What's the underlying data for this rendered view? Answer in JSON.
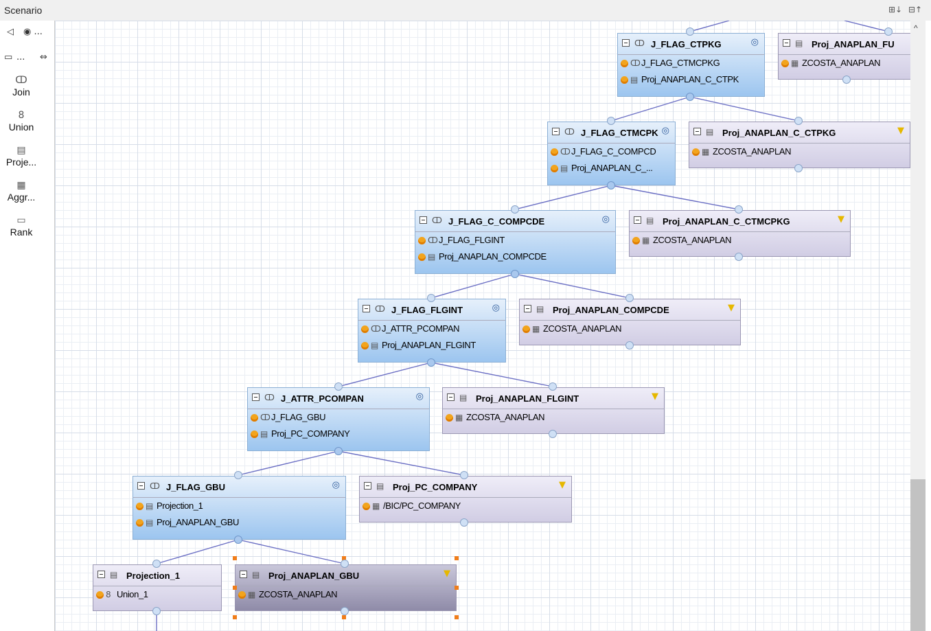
{
  "window": {
    "title": "Scenario",
    "expand_icon": "⊞↓",
    "collapse_icon": "⊟↑"
  },
  "palette": {
    "top_icons": [
      "◁",
      "◉ ..."
    ],
    "folder_label": "...",
    "items": [
      {
        "label": "Join",
        "icon": "join-icon",
        "glyph": "ↀ"
      },
      {
        "label": "Union",
        "icon": "union-icon",
        "glyph": "8"
      },
      {
        "label": "Proje...",
        "icon": "projection-icon",
        "glyph": "▤"
      },
      {
        "label": "Aggr...",
        "icon": "aggregation-icon",
        "glyph": "▦"
      },
      {
        "label": "Rank",
        "icon": "rank-icon",
        "glyph": "▭"
      }
    ]
  },
  "nodes": {
    "j_flag_ctpkg": {
      "title": "J_FLAG_CTPKG",
      "rows": [
        "J_FLAG_CTMCPKG",
        "Proj_ANAPLAN_C_CTPK"
      ]
    },
    "proj_anaplan_fu": {
      "title": "Proj_ANAPLAN_FU",
      "rows": [
        "ZCOSTA_ANAPLAN"
      ]
    },
    "j_flag_ctmcpk": {
      "title": "J_FLAG_CTMCPK",
      "rows": [
        "J_FLAG_C_COMPCD",
        "Proj_ANAPLAN_C_..."
      ]
    },
    "proj_anaplan_c_ctpkg": {
      "title": "Proj_ANAPLAN_C_CTPKG",
      "rows": [
        "ZCOSTA_ANAPLAN"
      ]
    },
    "j_flag_c_compcde": {
      "title": "J_FLAG_C_COMPCDE",
      "rows": [
        "J_FLAG_FLGINT",
        "Proj_ANAPLAN_COMPCDE"
      ]
    },
    "proj_anaplan_c_ctmcpkg": {
      "title": "Proj_ANAPLAN_C_CTMCPKG",
      "rows": [
        "ZCOSTA_ANAPLAN"
      ]
    },
    "j_flag_flgint": {
      "title": "J_FLAG_FLGINT",
      "rows": [
        "J_ATTR_PCOMPAN",
        "Proj_ANAPLAN_FLGINT"
      ]
    },
    "proj_anaplan_compcde": {
      "title": "Proj_ANAPLAN_COMPCDE",
      "rows": [
        "ZCOSTA_ANAPLAN"
      ]
    },
    "j_attr_pcompan": {
      "title": "J_ATTR_PCOMPAN",
      "rows": [
        "J_FLAG_GBU",
        "Proj_PC_COMPANY"
      ]
    },
    "proj_anaplan_flgint": {
      "title": "Proj_ANAPLAN_FLGINT",
      "rows": [
        "ZCOSTA_ANAPLAN"
      ]
    },
    "j_flag_gbu": {
      "title": "J_FLAG_GBU",
      "rows": [
        "Projection_1",
        "Proj_ANAPLAN_GBU"
      ]
    },
    "proj_pc_company": {
      "title": "Proj_PC_COMPANY",
      "rows": [
        "/BIC/PC_COMPANY"
      ]
    },
    "projection_1": {
      "title": "Projection_1",
      "rows": [
        "Union_1"
      ]
    },
    "proj_anaplan_gbu": {
      "title": "Proj_ANAPLAN_GBU",
      "rows": [
        "ZCOSTA_ANAPLAN"
      ]
    }
  },
  "icons": {
    "join": "ↀ",
    "projection": "▤",
    "table": "▦",
    "union": "8",
    "join_badge": "◎",
    "filter": "▼"
  },
  "colors": {
    "join_node": "#9cc5ef",
    "projection_node": "#d1cde4",
    "connector": "#6b6fc4",
    "port_dot": "#f2a41d",
    "selection": "#f07d1a",
    "filter": "#e6b800"
  }
}
